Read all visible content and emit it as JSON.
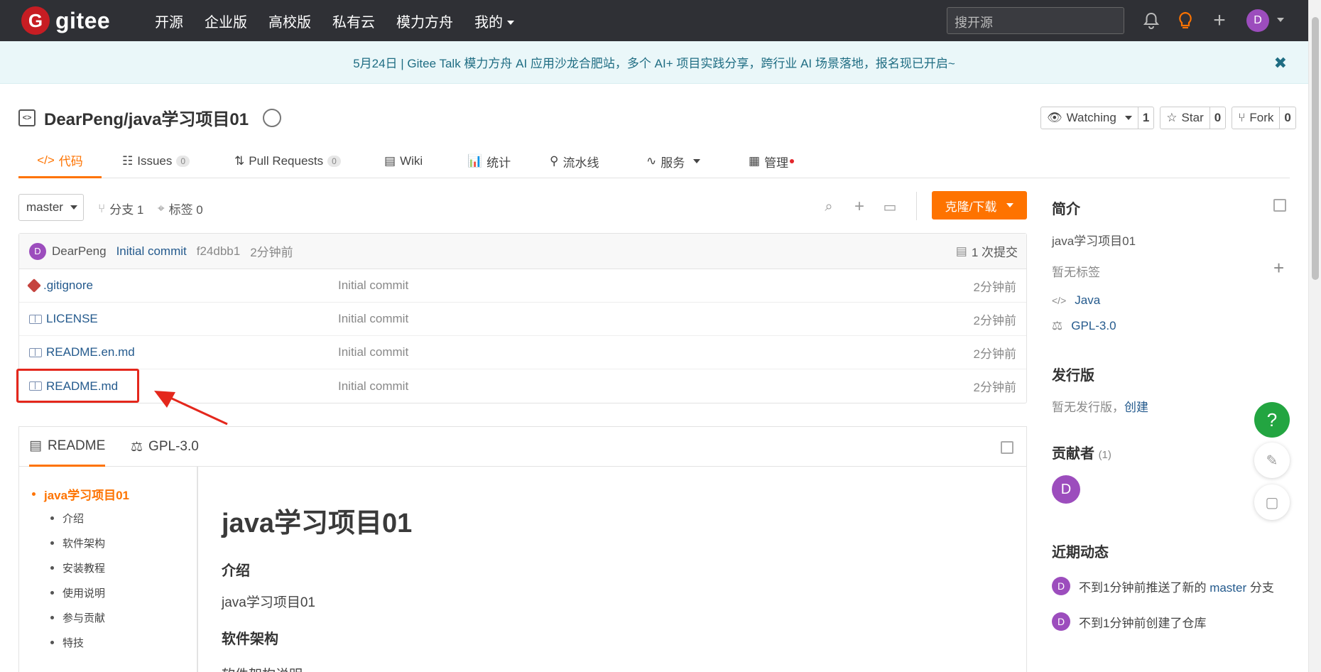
{
  "topnav": {
    "logo_mark": "G",
    "logo_text": "gitee",
    "links": [
      "开源",
      "企业版",
      "高校版",
      "私有云",
      "模力方舟",
      "我的"
    ],
    "search_placeholder": "搜开源",
    "avatar_letter": "D"
  },
  "banner": {
    "text": "5月24日 | Gitee Talk 模力方舟 AI 应用沙龙合肥站，多个 AI+ 项目实践分享，跨行业 AI 场景落地，报名现已开启~",
    "close": "✖"
  },
  "repo": {
    "title": "DearPeng/java学习项目01",
    "actions": [
      {
        "label": "Watching",
        "count": "1"
      },
      {
        "label": "Star",
        "count": "0"
      },
      {
        "label": "Fork",
        "count": "0"
      }
    ]
  },
  "tabs": [
    {
      "label": "代码"
    },
    {
      "label": "Issues",
      "count": "0"
    },
    {
      "label": "Pull Requests",
      "count": "0"
    },
    {
      "label": "Wiki"
    },
    {
      "label": "统计"
    },
    {
      "label": "流水线"
    },
    {
      "label": "服务"
    },
    {
      "label": "管理"
    }
  ],
  "branchbar": {
    "branch": "master",
    "branches": "分支 1",
    "tags": "标签 0",
    "clone_label": "克隆/下载"
  },
  "commit": {
    "avatar": "D",
    "author": "DearPeng",
    "message": "Initial commit",
    "hash": "f24dbb1",
    "time": "2分钟前",
    "count": "1 次提交"
  },
  "files": [
    {
      "name": ".gitignore",
      "message": "Initial commit",
      "time": "2分钟前"
    },
    {
      "name": "LICENSE",
      "message": "Initial commit",
      "time": "2分钟前"
    },
    {
      "name": "README.en.md",
      "message": "Initial commit",
      "time": "2分钟前"
    },
    {
      "name": "README.md",
      "message": "Initial commit",
      "time": "2分钟前"
    }
  ],
  "readme": {
    "tab_readme": "README",
    "tab_license": "GPL-3.0",
    "toc": [
      "java学习项目01",
      "介绍",
      "软件架构",
      "安装教程",
      "使用说明",
      "参与贡献",
      "特技"
    ],
    "h1": "java学习项目01",
    "h_intro": "介绍",
    "p_intro": "java学习项目01",
    "h_arch": "软件架构",
    "p_arch": "软件架构说明"
  },
  "sidebar": {
    "intro_title": "简介",
    "intro_text": "java学习项目01",
    "no_tags": "暂无标签",
    "language": "Java",
    "license": "GPL-3.0",
    "release_title": "发行版",
    "no_release": "暂无发行版，",
    "create": "创建",
    "contrib_title": "贡献者",
    "contrib_count": "(1)",
    "contrib_avatar": "D",
    "activity_title": "近期动态",
    "activity": [
      {
        "avatar": "D",
        "prefix": "不到1分钟前推送了新的 ",
        "branch": "master",
        "suffix": " 分支"
      },
      {
        "avatar": "D",
        "text": "不到1分钟前创建了仓库"
      }
    ]
  },
  "fab": {
    "help": "?"
  },
  "colors": {
    "brand": "#c71d23",
    "accent": "#fe7300",
    "link": "#245a8d",
    "nav_bg": "#2f3035",
    "highlight": "#e4271c"
  }
}
